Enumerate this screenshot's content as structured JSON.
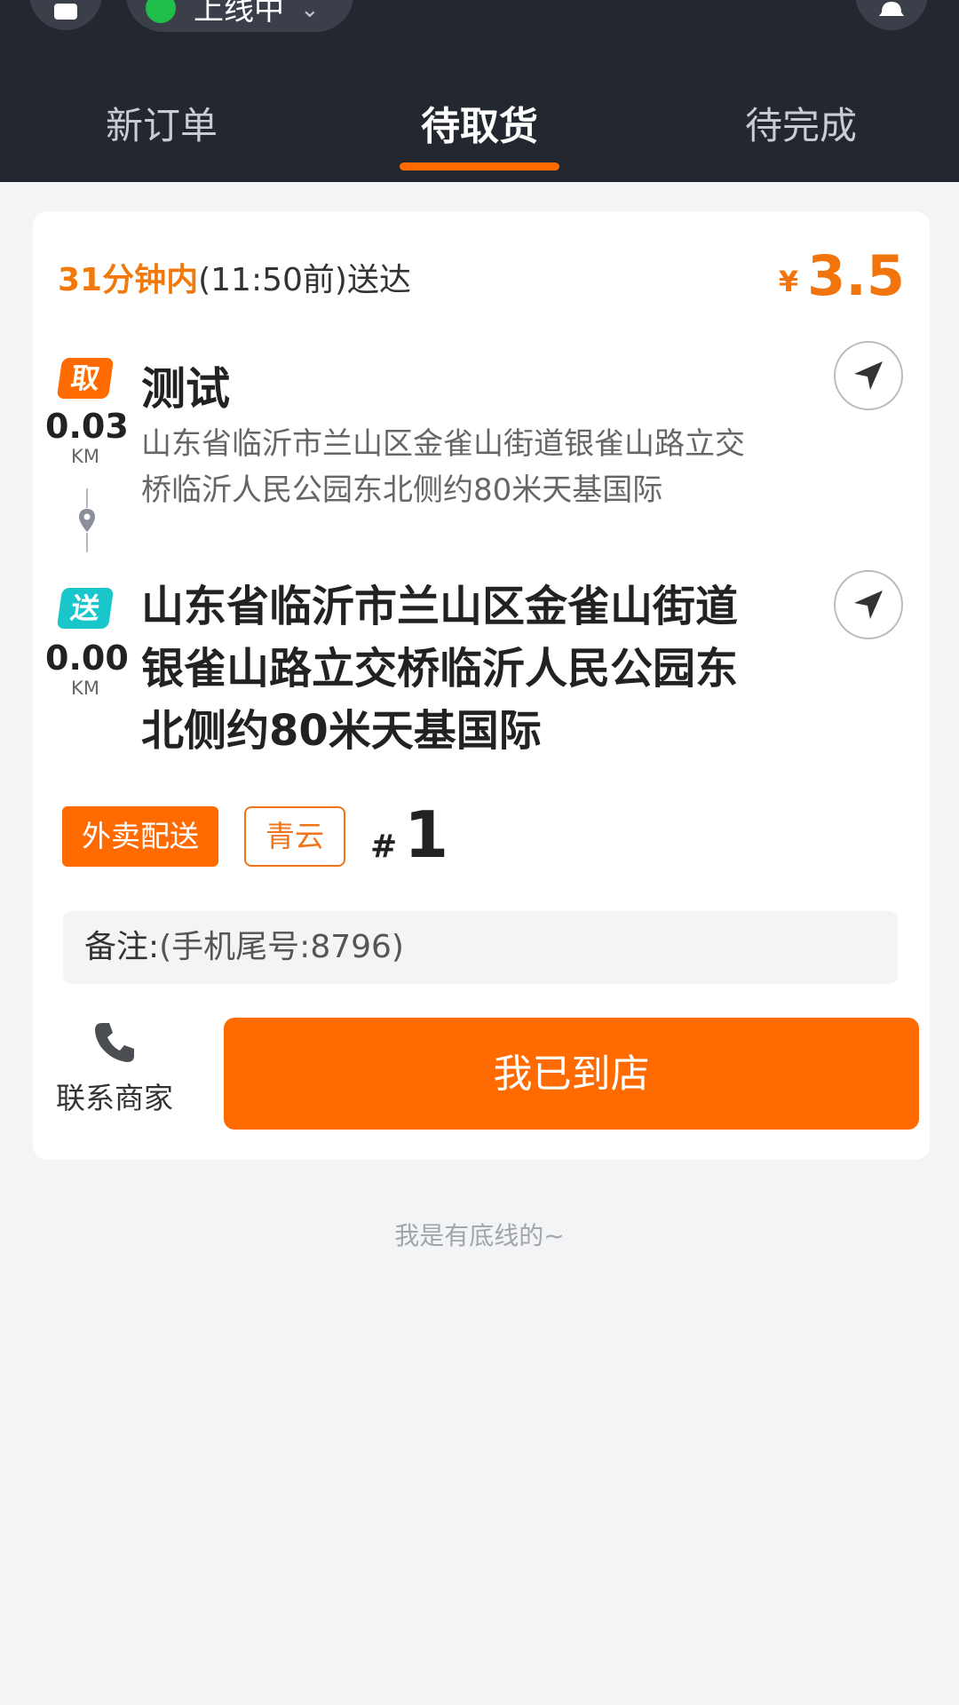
{
  "header": {
    "status_label": "上线中",
    "tabs": [
      {
        "label": "新订单"
      },
      {
        "label": "待取货"
      },
      {
        "label": "待完成"
      }
    ],
    "active_tab_index": 1
  },
  "order": {
    "deadline_highlight": "31分钟内",
    "deadline_rest": "(11:50前)送达",
    "price_currency": "¥",
    "price_amount": "3.5",
    "pickup": {
      "tag": "取",
      "distance": "0.03",
      "unit": "KM",
      "name": "测试",
      "address": "山东省临沂市兰山区金雀山街道银雀山路立交桥临沂人民公园东北侧约80米天基国际"
    },
    "dropoff": {
      "tag": "送",
      "distance": "0.00",
      "unit": "KM",
      "address": "山东省临沂市兰山区金雀山街道银雀山路立交桥临沂人民公园东北侧约80米天基国际"
    },
    "delivery_type": "外卖配送",
    "platform": "青云",
    "seq_hash": "#",
    "seq_number": "1",
    "remark_label": "备注:",
    "remark_value": "(手机尾号:8796)",
    "contact_label": "联系商家",
    "arrive_button": "我已到店"
  },
  "footer_note": "我是有底线的~",
  "colors": {
    "accent": "#ff6b00",
    "header_bg": "#232730",
    "drop_tag": "#19c6c9",
    "online_dot": "#1fbf4a"
  }
}
